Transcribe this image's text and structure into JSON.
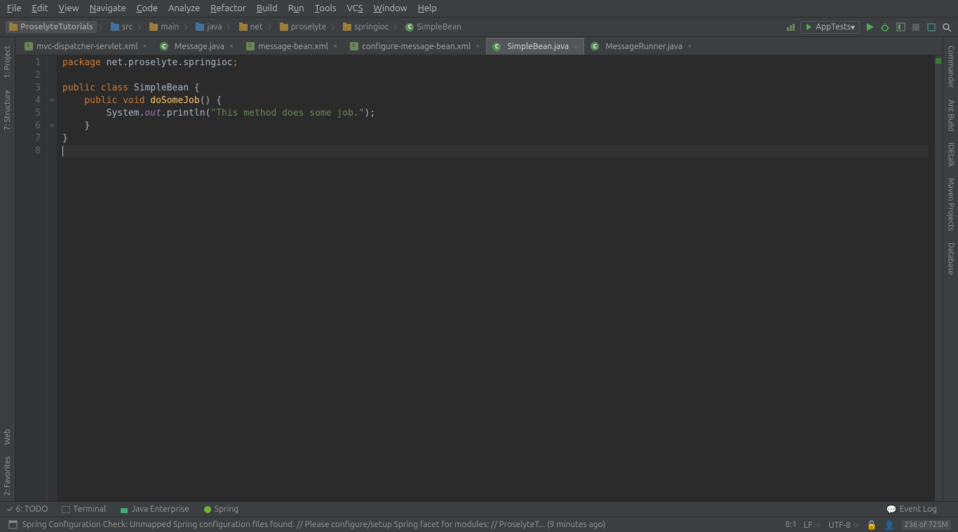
{
  "menu": {
    "items": [
      "File",
      "Edit",
      "View",
      "Navigate",
      "Code",
      "Analyze",
      "Refactor",
      "Build",
      "Run",
      "Tools",
      "VCS",
      "Window",
      "Help"
    ]
  },
  "breadcrumb": {
    "items": [
      {
        "label": "ProselyteTutorials",
        "type": "project"
      },
      {
        "label": "src",
        "type": "folder-blue"
      },
      {
        "label": "main",
        "type": "folder"
      },
      {
        "label": "java",
        "type": "folder-blue"
      },
      {
        "label": "net",
        "type": "folder"
      },
      {
        "label": "proselyte",
        "type": "folder"
      },
      {
        "label": "springioc",
        "type": "folder"
      },
      {
        "label": "SimpleBean",
        "type": "class"
      }
    ]
  },
  "runconfig": {
    "label": "AppTests"
  },
  "left_rail": [
    {
      "label": "1: Project",
      "icon": "project-icon"
    },
    {
      "label": "7: Structure",
      "icon": "structure-icon"
    },
    {
      "label": "Web",
      "icon": "web-icon"
    },
    {
      "label": "2: Favorites",
      "icon": "favorites-icon"
    }
  ],
  "right_rail": [
    {
      "label": "Commander"
    },
    {
      "label": "Ant Build"
    },
    {
      "label": "IDEtalk"
    },
    {
      "label": "Maven Projects"
    },
    {
      "label": "Database"
    }
  ],
  "tabs": [
    {
      "label": "mvc-dispatcher-servlet.xml",
      "type": "spring-xml"
    },
    {
      "label": "Message.java",
      "type": "class"
    },
    {
      "label": "message-bean.xml",
      "type": "spring-xml"
    },
    {
      "label": "configure-message-bean.xml",
      "type": "spring-xml"
    },
    {
      "label": "SimpleBean.java",
      "type": "class",
      "active": true
    },
    {
      "label": "MessageRunner.java",
      "type": "class"
    }
  ],
  "code": {
    "lines": [
      1,
      2,
      3,
      4,
      5,
      6,
      7,
      8
    ],
    "tokens": {
      "package": "package",
      "pkg_name": "net.proselyte.springioc",
      "semi": ";",
      "public": "public",
      "class_kw": "class",
      "class_name": "SimpleBean",
      "ob": "{",
      "void": "void",
      "method": "doSomeJob",
      "par": "()",
      "system": "System",
      "out": "out",
      "println": ".println(",
      "str": "\"This method does some job.\"",
      "cp": ");",
      "cb": "}"
    }
  },
  "bottom_tools": {
    "left": [
      {
        "label": "6: TODO",
        "icon": "todo-icon"
      },
      {
        "label": "Terminal",
        "icon": "terminal-icon"
      },
      {
        "label": "Java Enterprise",
        "icon": "jee-icon"
      },
      {
        "label": "Spring",
        "icon": "spring-icon"
      }
    ],
    "right": {
      "label": "Event Log",
      "icon": "event-log-icon"
    }
  },
  "status": {
    "message": "Spring Configuration Check: Unmapped Spring configuration files found. // Please configure/setup Spring facet for modules: // ProselyteT... (9 minutes ago)",
    "pos": "8:1",
    "lf": "LF",
    "enc": "UTF-8",
    "mem": "236 of 725M"
  }
}
